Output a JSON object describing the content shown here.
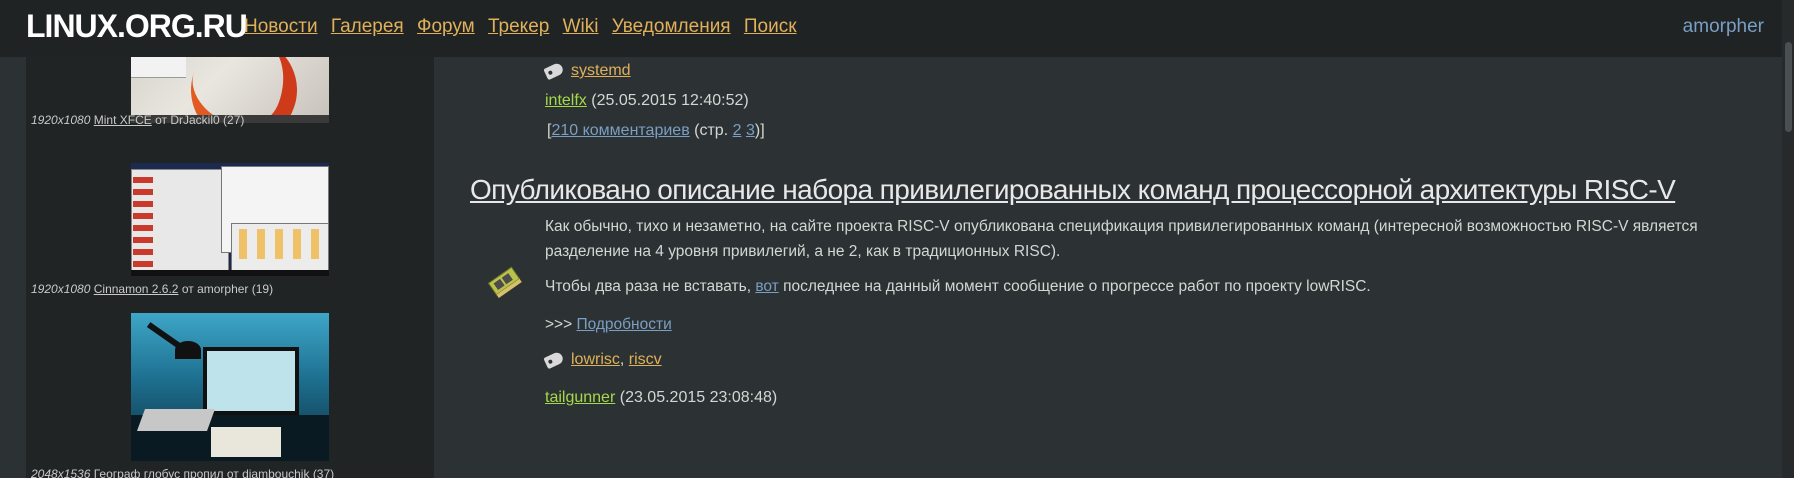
{
  "header": {
    "logo": "LINUX.ORG.RU",
    "nav": [
      "Новости",
      "Галерея",
      "Форум",
      "Трекер",
      "Wiki",
      "Уведомления",
      "Поиск"
    ],
    "user": "amorpher"
  },
  "sidebar": {
    "gallery": [
      {
        "resolution": "1920x1080",
        "title": "Mint XFCE",
        "from": "от",
        "author": "DrJackil0",
        "count": "(27)"
      },
      {
        "resolution": "1920x1080",
        "title": "Cinnamon 2.6.2",
        "from": "от",
        "author": "amorpher",
        "count": "(19)"
      },
      {
        "resolution": "2048x1536",
        "title": "Географ глобус пропил",
        "from": "от",
        "author": "diambouchik",
        "count": "(37)"
      }
    ]
  },
  "main": {
    "prev_item": {
      "tags": [
        "systemd"
      ],
      "author": "intelfx",
      "date": "(25.05.2015 12:40:52)",
      "comments_open": "[",
      "comments_link": "210 комментариев",
      "pages_prefix": "(стр.",
      "pages": [
        "2",
        "3"
      ],
      "pages_close": ")]"
    },
    "news": {
      "title": "Опубликовано описание набора привилегированных команд процессорной архитектуры RISC-V",
      "paragraph1": "Как обычно, тихо и незаметно, на сайте проекта RISC-V опубликована спецификация привилегированных команд (интересной возможностью RISC-V является разделение на 4 уровня привилегий, а не 2, как в традиционных RISC).",
      "paragraph2_before": "Чтобы два раза не вставать,",
      "paragraph2_link": "вот",
      "paragraph2_after": "последнее на данный момент сообщение о прогрессе работ по проекту lowRISC.",
      "more_prefix": ">>>",
      "more_link": "Подробности",
      "tags": [
        "lowrisc",
        "riscv"
      ],
      "author": "tailgunner",
      "date": "(23.05.2015 23:08:48)"
    }
  },
  "colors": {
    "background": "#2c3233",
    "header": "#1f2324",
    "sidebar": "#202425",
    "nav_link": "#e0b05a",
    "user_link": "#7a9ec4",
    "author_link": "#a6d84a"
  }
}
